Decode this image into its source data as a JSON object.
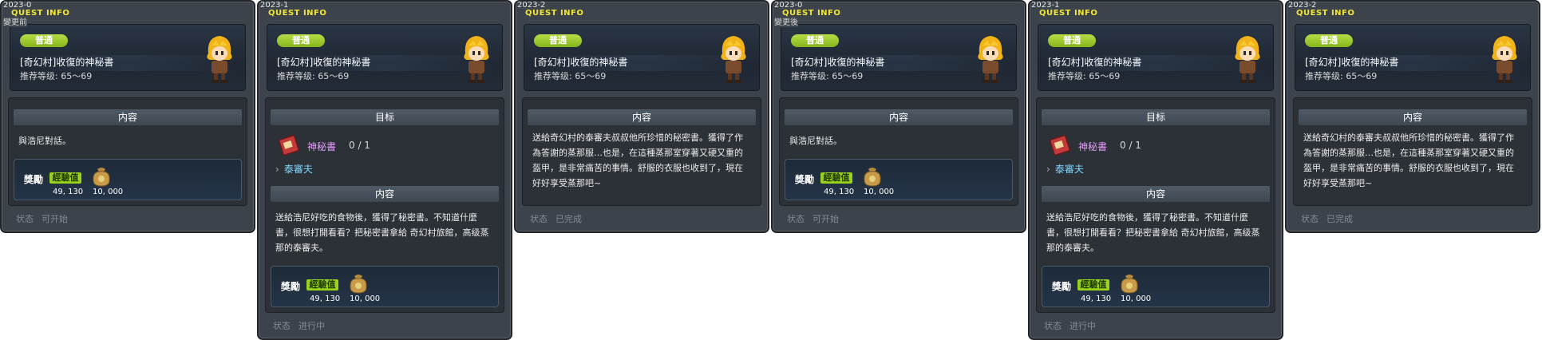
{
  "panels": [
    {
      "version": "2023-0",
      "note": "變更前",
      "title": "QUEST INFO",
      "badge": "普通",
      "quest_name": "[奇幻村]收復的神秘書",
      "level": "推荐等级: 65～69",
      "section1": "内容",
      "text": "與浩尼對話。",
      "reward_label": "獎勵",
      "exp_label": "經驗值",
      "exp": "49, 130",
      "meso": "10, 000",
      "status_label": "状态",
      "status_value": "可开始"
    },
    {
      "version": "2023-1",
      "title": "QUEST INFO",
      "badge": "普通",
      "quest_name": "[奇幻村]收復的神秘書",
      "level": "推荐等级: 65～69",
      "section1": "目标",
      "item_name": "神秘書",
      "item_count": "0 / 1",
      "npc_target": "泰審夫",
      "section2": "内容",
      "text": "送給浩尼好吃的食物後，獲得了秘密書。不知道什麼書，很想打開看看？把秘密書拿給 奇幻村旅館，高级蒸那的泰審夫。",
      "reward_label": "獎勵",
      "exp_label": "經驗值",
      "exp": "49, 130",
      "meso": "10, 000",
      "status_label": "状态",
      "status_value": "进行中"
    },
    {
      "version": "2023-2",
      "title": "QUEST INFO",
      "badge": "普通",
      "quest_name": "[奇幻村]收復的神秘書",
      "level": "推荐等级: 65～69",
      "section1": "内容",
      "text": "送給奇幻村的泰審夫叔叔他所珍惜的秘密書。獲得了作為答謝的蒸那服…也是，在這種蒸那室穿著又硬又重的盔甲，是非常痛苦的事情。舒服的衣服也收到了，現在好好享受蒸那吧~",
      "status_label": "状态",
      "status_value": "已完成"
    },
    {
      "version": "2023-0",
      "note": "變更後",
      "title": "QUEST INFO",
      "badge": "普通",
      "quest_name": "[奇幻村]收復的神秘書",
      "level": "推荐等级: 65～69",
      "section1": "内容",
      "text": "與浩尼對話。",
      "reward_label": "獎勵",
      "exp_label": "經驗值",
      "exp": "49, 130",
      "meso": "10, 000",
      "status_label": "状态",
      "status_value": "可开始"
    },
    {
      "version": "2023-1",
      "title": "QUEST INFO",
      "badge": "普通",
      "quest_name": "[奇幻村]收復的神秘書",
      "level": "推荐等级: 65～69",
      "section1": "目标",
      "item_name": "神秘書",
      "item_count": "0 / 1",
      "npc_target": "泰審夫",
      "section2": "内容",
      "text": "送給浩尼好吃的食物後，獲得了秘密書。不知道什麼書，很想打開看看？把秘密書拿給 奇幻村旅館，高级蒸那的泰審夫。",
      "reward_label": "獎勵",
      "exp_label": "經驗值",
      "exp": "49, 130",
      "meso": "10, 000",
      "status_label": "状态",
      "status_value": "进行中"
    },
    {
      "version": "2023-2",
      "title": "QUEST INFO",
      "badge": "普通",
      "quest_name": "[奇幻村]收復的神秘書",
      "level": "推荐等级: 65～69",
      "section1": "内容",
      "text": "送給奇幻村的泰審夫叔叔他所珍惜的秘密書。獲得了作為答謝的蒸那服…也是，在這種蒸那室穿著又硬又重的盔甲，是非常痛苦的事情。舒服的衣服也收到了，現在好好享受蒸那吧~",
      "status_label": "状态",
      "status_value": "已完成"
    }
  ]
}
